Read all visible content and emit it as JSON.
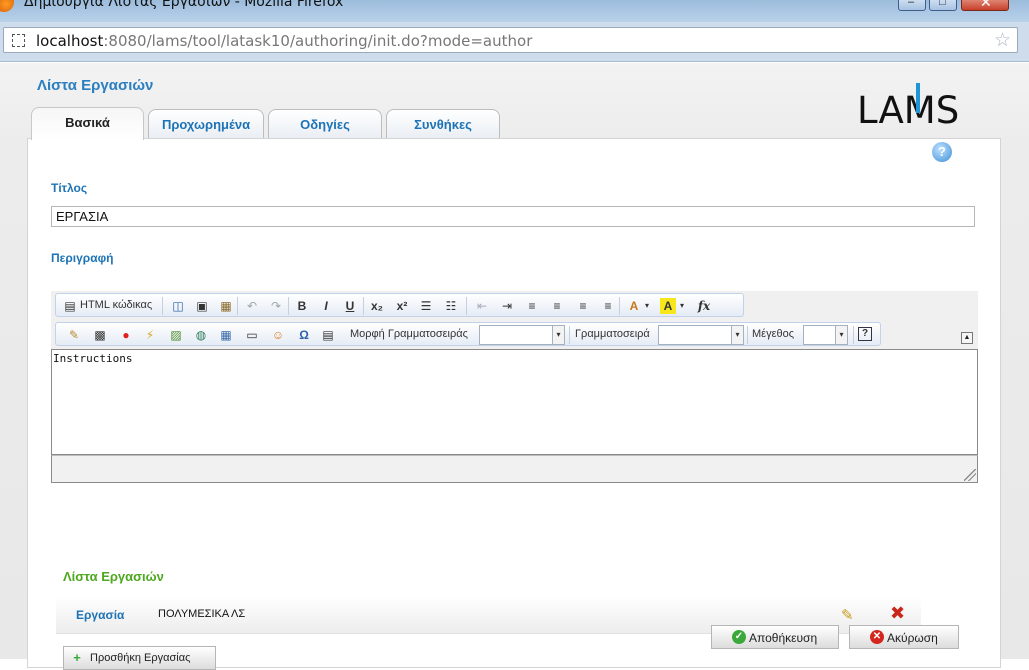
{
  "window": {
    "title": "Δημιουργία Λίστας Εργασιών - Mozilla Firefox",
    "min_glyph": "–",
    "max_glyph": "□",
    "close_glyph": "✕"
  },
  "urlbar": {
    "host": "localhost",
    "path": ":8080/lams/tool/latask10/authoring/init.do?mode=author",
    "star_glyph": "☆"
  },
  "page": {
    "title": "Λίστα Εργασιών",
    "logo": {
      "prefix": "LA",
      "m": "M",
      "suffix": "S"
    }
  },
  "tabs": [
    {
      "label": "Βασικά"
    },
    {
      "label": "Προχωρημένα"
    },
    {
      "label": "Οδηγίες"
    },
    {
      "label": "Συνθήκες"
    }
  ],
  "form": {
    "help_glyph": "?",
    "title_label": "Τίτλος",
    "title_value": "ΕΡΓΑΣΙΑ",
    "description_label": "Περιγραφή"
  },
  "editor": {
    "html_source_label": "HTML κώδικας",
    "font_format_label": "Μορφή Γραμματοσειράς",
    "font_family_label": "Γραμματοσειρά",
    "font_size_label": "Μέγεθος",
    "font_format_value": "",
    "font_family_value": "",
    "font_size_value": "",
    "content": "Instructions",
    "glyphs": {
      "source": "▤",
      "preview": "◫",
      "preview2": "▣",
      "paste": "▦",
      "undo": "↶",
      "redo": "↷",
      "bold": "B",
      "italic": "I",
      "underline": "U",
      "subscript": "x₂",
      "superscript": "x²",
      "ordered_list": "☰",
      "unordered_list": "☷",
      "outdent": "⇤",
      "indent": "⇥",
      "align_left": "≡",
      "align_center": "≡",
      "align_right": "≡",
      "justify": "≡",
      "text_color": "A",
      "bg_color": "A",
      "formula": "fx",
      "pencil": "✎",
      "film": "▩",
      "record": "●",
      "flash": "⚡",
      "image": "▨",
      "globe": "◍",
      "table": "▦",
      "hr": "▭",
      "smiley": "☺",
      "omega": "Ω",
      "page": "▤",
      "help": "?",
      "dropdown": "▾",
      "collapse": "▲"
    }
  },
  "tasks": {
    "section_label": "Λίστα Εργασιών",
    "items": [
      {
        "label": "Εργασία",
        "name": "ΠΟΛΥΜΕΣΙΚΑ ΛΣ",
        "edit_glyph": "✎",
        "delete_glyph": "✖"
      }
    ],
    "add_label": "Προσθήκη Εργασίας",
    "add_glyph": "+"
  },
  "actions": {
    "save_label": "Αποθήκευση",
    "save_glyph": "✓",
    "cancel_label": "Ακύρωση",
    "cancel_glyph": "✕"
  },
  "colors": {
    "accent_blue": "#1c73b5",
    "section_green": "#4ea81f",
    "save_green": "#3aa83a",
    "cancel_red": "#d3261c"
  }
}
